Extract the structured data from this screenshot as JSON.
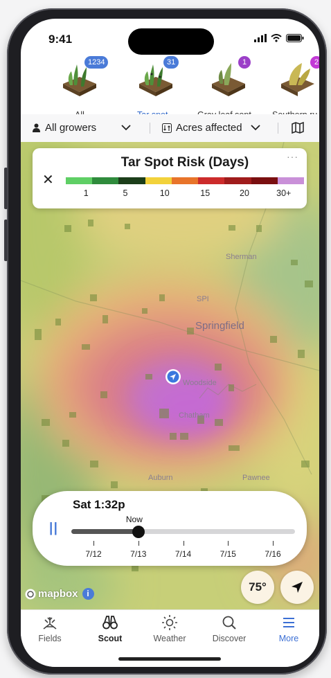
{
  "status_bar": {
    "time": "9:41"
  },
  "crop_tabs": [
    {
      "label": "All",
      "badge": "1234",
      "badge_color": "#4a7bd8"
    },
    {
      "label": "Tar spot",
      "badge": "31",
      "badge_color": "#4a7bd8",
      "active": true
    },
    {
      "label": "Gray leaf sopt",
      "badge": "1",
      "badge_color": "#9b3fc8"
    },
    {
      "label": "Southern ru",
      "badge": "2",
      "badge_color": "#c23ad6"
    }
  ],
  "filters": {
    "growers": "All growers",
    "acres": "Acres affected"
  },
  "legend": {
    "title": "Tar Spot Risk (Days)",
    "colors": [
      "#5fcf65",
      "#2f8b3c",
      "#1c3e1a",
      "#f2d23b",
      "#e8742a",
      "#cc2b2b",
      "#a01c1c",
      "#7a0f10",
      "#c990d8"
    ],
    "ticks": [
      "1",
      "5",
      "10",
      "15",
      "20",
      "30+"
    ]
  },
  "map_labels": {
    "sherman": "Sherman",
    "spi": "SPI",
    "springfield": "Springfield",
    "woodside": "Woodside",
    "chatham": "Chatham",
    "auburn": "Auburn",
    "pawnee": "Pawnee"
  },
  "timeline": {
    "current": "Sat 1:32p",
    "now_label": "Now",
    "dates": [
      "7/12",
      "7/13",
      "7/14",
      "7/15",
      "7/16"
    ],
    "progress": 0.3
  },
  "map_controls": {
    "temperature": "75°",
    "attribution": "mapbox",
    "info": "i"
  },
  "bottom_nav": [
    {
      "label": "Fields",
      "icon": "fields-icon"
    },
    {
      "label": "Scout",
      "icon": "binoculars-icon"
    },
    {
      "label": "Weather",
      "icon": "sun-icon"
    },
    {
      "label": "Discover",
      "icon": "search-icon"
    },
    {
      "label": "More",
      "icon": "menu-icon",
      "active": true
    }
  ]
}
